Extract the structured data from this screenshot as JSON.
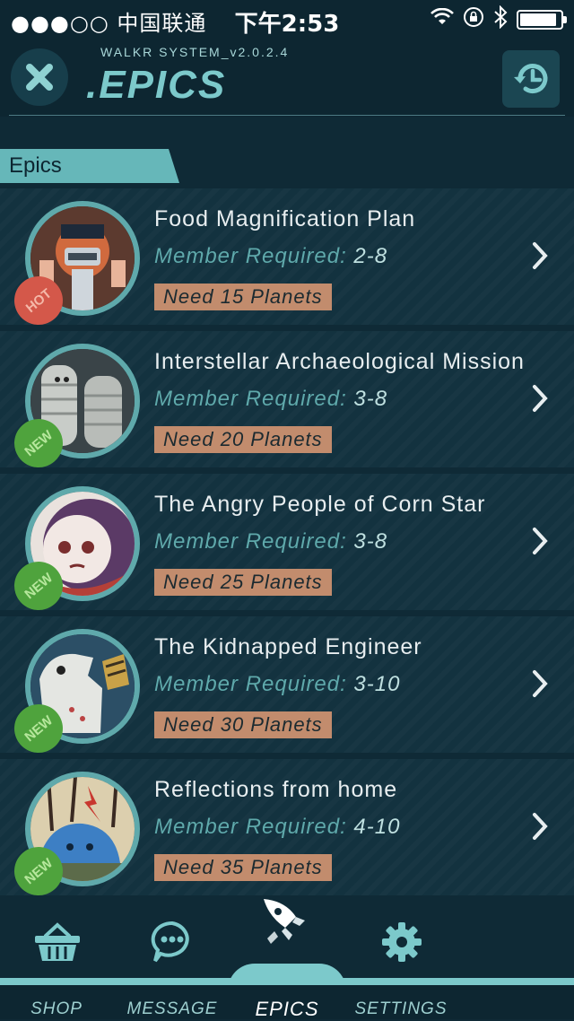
{
  "status_bar": {
    "carrier": "●●●○○ 中国联通",
    "time": "下午2:53",
    "battery_level": 0.9
  },
  "header": {
    "system_version": "WALKR SYSTEM_v2.0.2.4",
    "title": ".EPICS",
    "close_icon": "close-x-icon",
    "history_icon": "history-clock-icon"
  },
  "section": {
    "label": "Epics"
  },
  "epics": [
    {
      "title": "Food Magnification Plan",
      "member_label": "Member Required:",
      "member_range": "2-8",
      "need": "Need 15 Planets",
      "badge": "HOT"
    },
    {
      "title": "Interstellar Archaeological Mission",
      "member_label": "Member Required:",
      "member_range": "3-8",
      "need": "Need 20 Planets",
      "badge": "NEW"
    },
    {
      "title": "The Angry People of Corn Star",
      "member_label": "Member Required:",
      "member_range": "3-8",
      "need": "Need 25 Planets",
      "badge": "NEW"
    },
    {
      "title": "The Kidnapped Engineer",
      "member_label": "Member Required:",
      "member_range": "3-10",
      "need": "Need 30 Planets",
      "badge": "NEW"
    },
    {
      "title": "Reflections from home",
      "member_label": "Member Required:",
      "member_range": "4-10",
      "need": "Need 35 Planets",
      "badge": "NEW"
    }
  ],
  "tabbar": {
    "tabs": [
      {
        "label": "SHOP",
        "icon": "basket-icon"
      },
      {
        "label": "MESSAGE",
        "icon": "chat-bubble-icon"
      },
      {
        "label": "EPICS",
        "icon": "rocket-icon",
        "active": true
      },
      {
        "label": "SETTINGS",
        "icon": "gear-icon"
      }
    ]
  },
  "colors": {
    "background": "#0f2a36",
    "accent": "#7cc9cb",
    "need_tag": "#c28c6d",
    "hot_badge": "#d4584a",
    "new_badge": "#4fa33d"
  }
}
